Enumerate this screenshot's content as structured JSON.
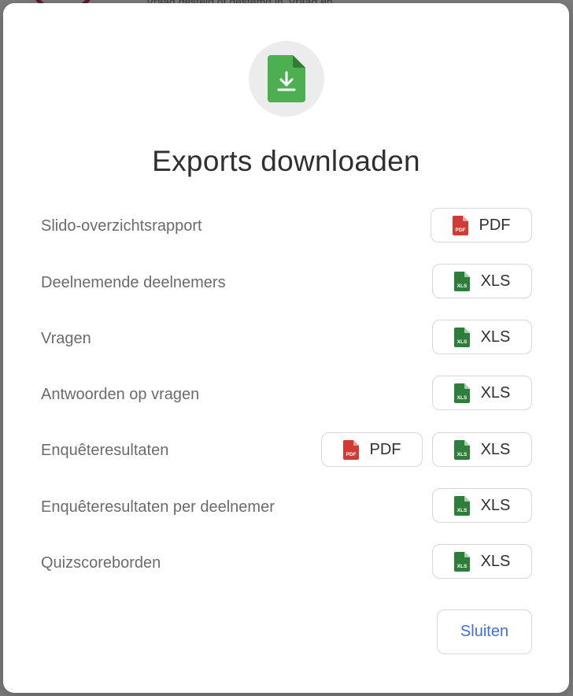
{
  "background": {
    "text": "Vraag gesteld of gestemd in 'Vraag en"
  },
  "dialog": {
    "title": "Exports downloaden",
    "close_label": "Sluiten",
    "rows": [
      {
        "label": "Slido-overzichtsrapport",
        "buttons": [
          "PDF"
        ]
      },
      {
        "label": "Deelnemende deelnemers",
        "buttons": [
          "XLS"
        ]
      },
      {
        "label": "Vragen",
        "buttons": [
          "XLS"
        ]
      },
      {
        "label": "Antwoorden op vragen",
        "buttons": [
          "XLS"
        ]
      },
      {
        "label": "Enquêteresultaten",
        "buttons": [
          "PDF",
          "XLS"
        ]
      },
      {
        "label": "Enquêteresultaten per deelnemer",
        "buttons": [
          "XLS"
        ]
      },
      {
        "label": "Quizscoreborden",
        "buttons": [
          "XLS"
        ]
      }
    ]
  },
  "icons": {
    "header": "download-file-icon",
    "pdf": "pdf-file-icon",
    "xls": "xls-file-icon"
  },
  "colors": {
    "pdf": "#d23b35",
    "xls": "#2f7d3a",
    "download": "#4caf50",
    "link": "#3f6fdb"
  }
}
